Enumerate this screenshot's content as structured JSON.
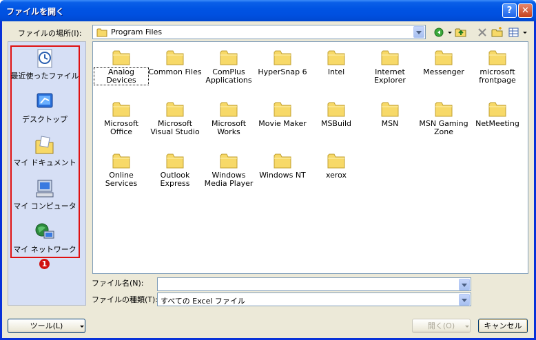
{
  "window": {
    "title": "ファイルを開く"
  },
  "titlebar": {
    "help_label": "?",
    "close_label": "✕"
  },
  "look_in": {
    "label": "ファイルの場所(I):",
    "value": "Program Files"
  },
  "places": [
    {
      "label": "最近使ったファイル",
      "icon": "recent-documents-icon"
    },
    {
      "label": "デスクトップ",
      "icon": "desktop-icon"
    },
    {
      "label": "マイ ドキュメント",
      "icon": "my-documents-icon"
    },
    {
      "label": "マイ コンピュータ",
      "icon": "my-computer-icon"
    },
    {
      "label": "マイ ネットワーク",
      "icon": "my-network-icon"
    }
  ],
  "annotation_badge": "1",
  "folders": [
    "Analog Devices",
    "Common Files",
    "ComPlus Applications",
    "HyperSnap 6",
    "Intel",
    "Internet Explorer",
    "Messenger",
    "microsoft frontpage",
    "Microsoft Office",
    "Microsoft Visual Studio",
    "Microsoft Works",
    "Movie Maker",
    "MSBuild",
    "MSN",
    "MSN Gaming Zone",
    "NetMeeting",
    "Online Services",
    "Outlook Express",
    "Windows Media Player",
    "Windows NT",
    "xerox"
  ],
  "filename": {
    "label": "ファイル名(N):",
    "value": ""
  },
  "filetype": {
    "label": "ファイルの種類(T):",
    "value": "すべての Excel ファイル"
  },
  "buttons": {
    "tools": "ツール(L)",
    "open": "開く(O)",
    "cancel": "キャンセル"
  },
  "colors": {
    "title_blue": "#0054e3",
    "dialog_bg": "#ece9d8",
    "highlight_red": "#e01010",
    "folder_yellow": "#f7d968"
  }
}
